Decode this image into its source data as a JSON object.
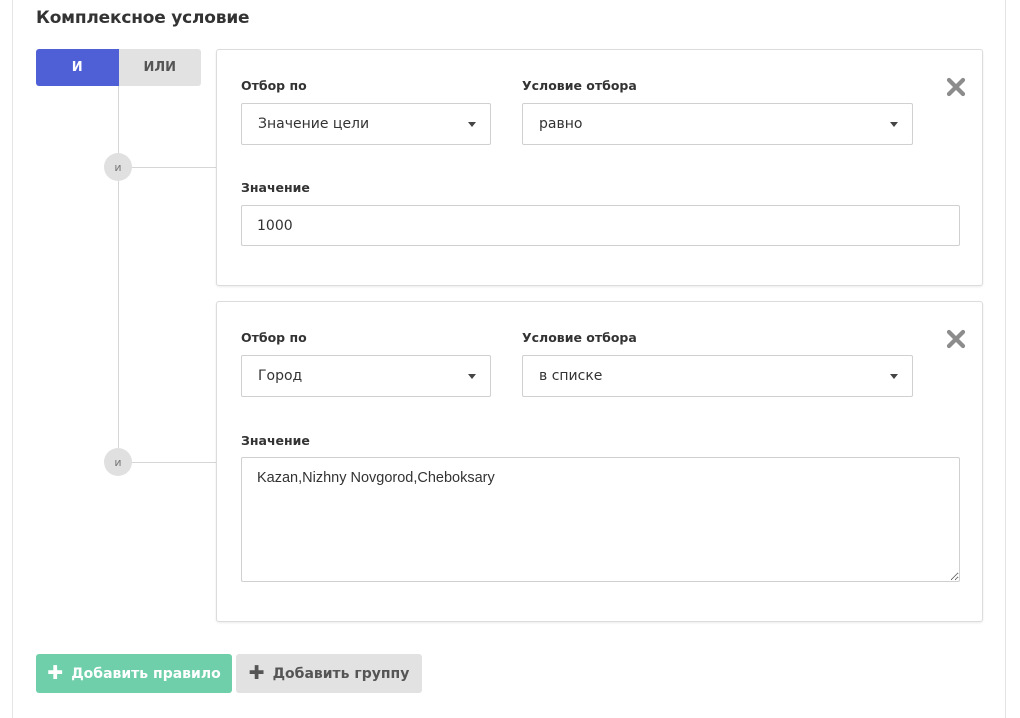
{
  "title": "Комплексное условие",
  "logic": {
    "and_label": "И",
    "or_label": "ИЛИ",
    "selected": "И"
  },
  "connectors": [
    "и",
    "и"
  ],
  "rules": [
    {
      "filter_by_label": "Отбор по",
      "filter_by_value": "Значение цели",
      "condition_label": "Условие отбора",
      "condition_value": "равно",
      "value_label": "Значение",
      "value": "1000",
      "close_icon": "close-x-icon"
    },
    {
      "filter_by_label": "Отбор по",
      "filter_by_value": "Город",
      "condition_label": "Условие отбора",
      "condition_value": "в списке",
      "value_label": "Значение",
      "value": "Kazan,Nizhny Novgorod,Cheboksary",
      "close_icon": "close-x-icon"
    }
  ],
  "actions": {
    "add_rule_label": "Добавить правило",
    "add_group_label": "Добавить группу",
    "plus_glyph": "✚"
  },
  "colors": {
    "and_active": "#4f5fd6",
    "add_rule": "#6fcfaa",
    "neutral_button": "#e2e2e2"
  }
}
